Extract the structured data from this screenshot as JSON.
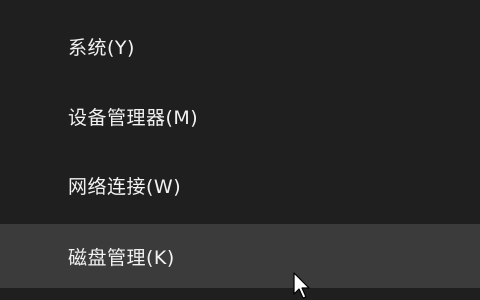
{
  "context_menu": {
    "items": [
      {
        "label": "系统(Y)"
      },
      {
        "label": "设备管理器(M)"
      },
      {
        "label": "网络连接(W)"
      },
      {
        "label": "磁盘管理(K)",
        "highlighted": true
      }
    ]
  },
  "colors": {
    "menu_background": "#1f1f1f",
    "highlight_background": "#3b3b3b",
    "text": "#f2f2f2"
  },
  "icons": {
    "cursor": "mouse-pointer-arrow-icon"
  }
}
